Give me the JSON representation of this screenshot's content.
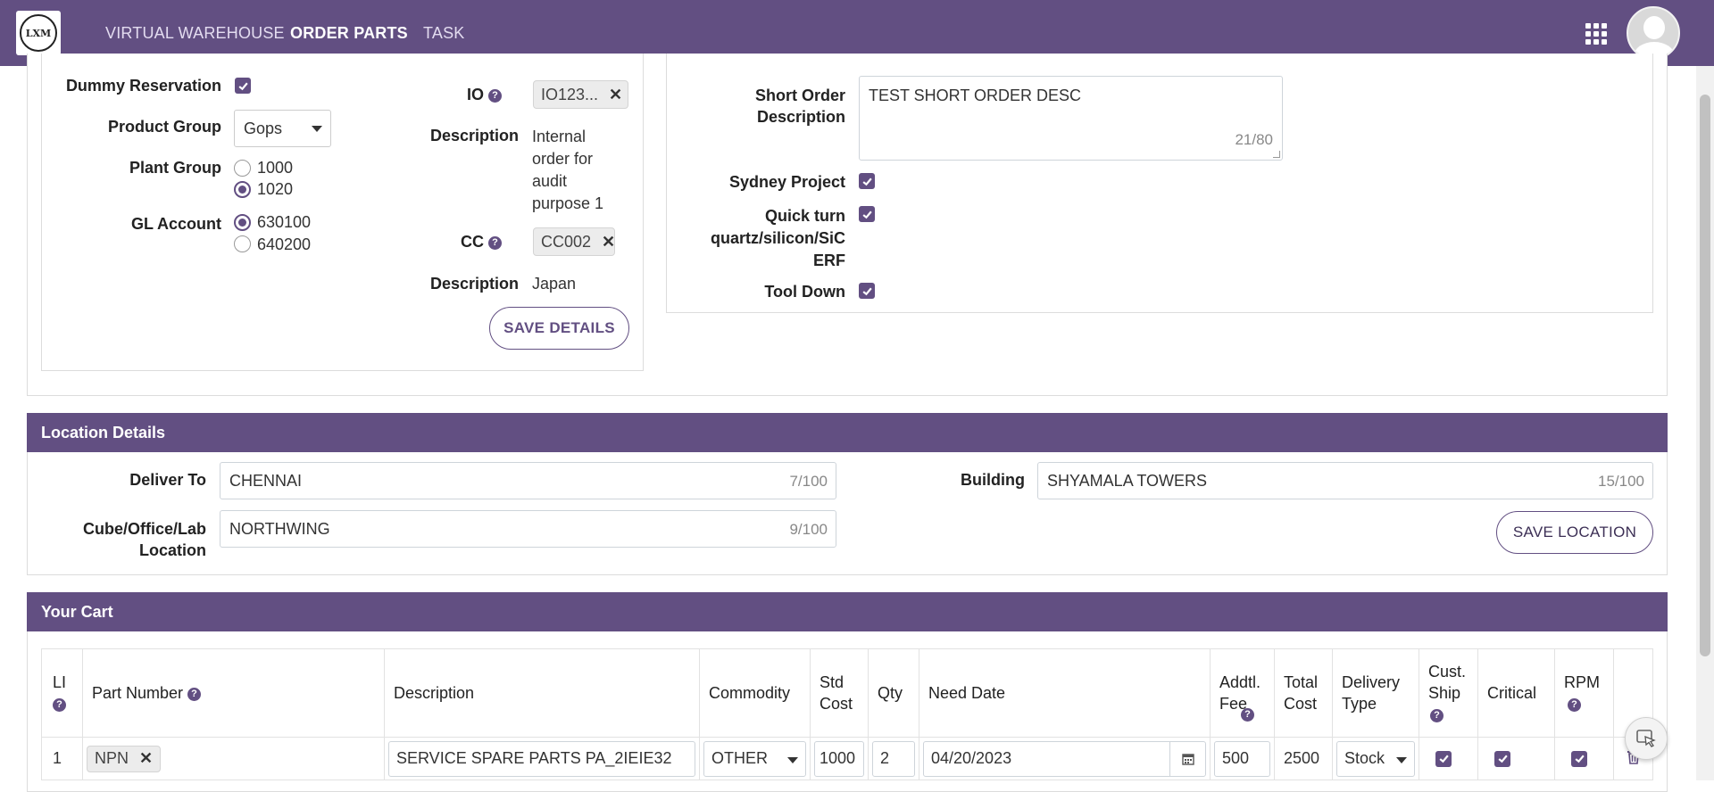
{
  "nav": {
    "items": [
      {
        "label": "VIRTUAL WAREHOUSE",
        "active": false
      },
      {
        "label": "ORDER PARTS",
        "active": true
      },
      {
        "label": "TASK",
        "active": false
      }
    ],
    "logo_text": "LXM"
  },
  "details": {
    "dummy_reservation_label": "Dummy Reservation",
    "dummy_reservation_checked": true,
    "product_group_label": "Product Group",
    "product_group_value": "Gops",
    "plant_group_label": "Plant Group",
    "plant_group_options": [
      {
        "label": "1000",
        "selected": false
      },
      {
        "label": "1020",
        "selected": true
      }
    ],
    "gl_account_label": "GL Account",
    "gl_account_options": [
      {
        "label": "630100",
        "selected": true
      },
      {
        "label": "640200",
        "selected": false
      }
    ],
    "io_label": "IO",
    "io_value": "IO123...",
    "description_label": "Description",
    "io_description": "Internal order for audit purpose 1",
    "cc_label": "CC",
    "cc_value": "CC002",
    "cc_description_label": "Description",
    "cc_description": "Japan",
    "save_details_label": "SAVE DETAILS",
    "short_order_label": "Short Order Description",
    "short_order_value": "TEST SHORT ORDER DESC",
    "short_order_counter": "21/80",
    "sydney_project_label": "Sydney Project",
    "quick_turn_label": "Quick turn quartz/silicon/SiC ERF",
    "tool_down_label": "Tool Down"
  },
  "location": {
    "title": "Location Details",
    "deliver_to_label": "Deliver To",
    "deliver_to_value": "CHENNAI",
    "deliver_to_counter": "7/100",
    "building_label": "Building",
    "building_value": "SHYAMALA TOWERS",
    "building_counter": "15/100",
    "cube_label": "Cube/Office/Lab Location",
    "cube_value": "NORTHWING",
    "cube_counter": "9/100",
    "save_location_label": "SAVE LOCATION"
  },
  "cart": {
    "title": "Your Cart",
    "columns": {
      "li": "LI",
      "part_number": "Part Number",
      "description": "Description",
      "commodity": "Commodity",
      "std_cost": "Std Cost",
      "qty": "Qty",
      "need_date": "Need Date",
      "addtl_fee": "Addtl. Fee",
      "total_cost": "Total Cost",
      "delivery_type": "Delivery Type",
      "cust_ship": "Cust. Ship",
      "critical": "Critical",
      "rpm": "RPM"
    },
    "rows": [
      {
        "li": "1",
        "part_number": "NPN",
        "description": "SERVICE SPARE PARTS PA_2IEIE32",
        "commodity": "OTHER",
        "std_cost": "1000",
        "qty": "2",
        "need_date": "04/20/2023",
        "addtl_fee": "500",
        "total_cost": "2500",
        "delivery_type": "Stock",
        "cust_ship": true,
        "critical": true,
        "rpm": true
      }
    ]
  },
  "colors": {
    "brand": "#624f82"
  }
}
